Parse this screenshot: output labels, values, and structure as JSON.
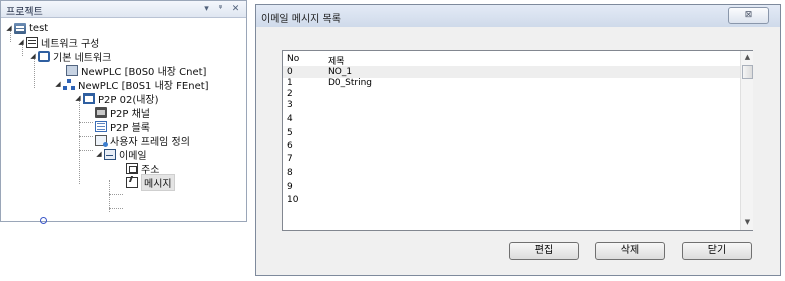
{
  "project_panel": {
    "title": "프로젝트",
    "header_icons": [
      "dropdown-icon",
      "pin-icon",
      "close-icon"
    ],
    "tree": [
      {
        "label": "test",
        "icon": "project-icon",
        "expanded": true
      },
      {
        "label": "네트워크 구성",
        "icon": "network-config-icon",
        "expanded": true
      },
      {
        "label": "기본 네트워크",
        "icon": "base-network-icon",
        "expanded": true
      },
      {
        "label": "NewPLC [B0S0 내장 Cnet]",
        "icon": "cnet-module-icon"
      },
      {
        "label": "NewPLC [B0S1 내장 FEnet]",
        "icon": "fenet-module-icon",
        "expanded": true
      },
      {
        "label": "P2P 02(내장)",
        "icon": "p2p-icon",
        "expanded": true
      },
      {
        "label": "P2P 채널",
        "icon": "p2p-channel-icon"
      },
      {
        "label": "P2P 블록",
        "icon": "p2p-block-icon"
      },
      {
        "label": "사용자 프레임 정의",
        "icon": "user-frame-icon"
      },
      {
        "label": "이메일",
        "icon": "email-icon",
        "expanded": true
      },
      {
        "label": "주소",
        "icon": "address-icon"
      },
      {
        "label": "메시지",
        "icon": "message-icon",
        "selected": true
      }
    ]
  },
  "dialog": {
    "title": "이메일 메시지 목록",
    "close_glyph": "⊠",
    "list": {
      "headers": {
        "no": "No",
        "title": "제목"
      },
      "rows": [
        {
          "no": "0",
          "title": "NO_1"
        },
        {
          "no": "1",
          "title": "D0_String"
        },
        {
          "no": "2",
          "title": ""
        },
        {
          "no": "3",
          "title": ""
        },
        {
          "no": "4",
          "title": ""
        },
        {
          "no": "5",
          "title": ""
        },
        {
          "no": "6",
          "title": ""
        },
        {
          "no": "7",
          "title": ""
        },
        {
          "no": "8",
          "title": ""
        },
        {
          "no": "9",
          "title": ""
        },
        {
          "no": "10",
          "title": ""
        }
      ]
    },
    "buttons": {
      "edit": "편집",
      "delete": "삭제",
      "close": "닫기"
    }
  }
}
